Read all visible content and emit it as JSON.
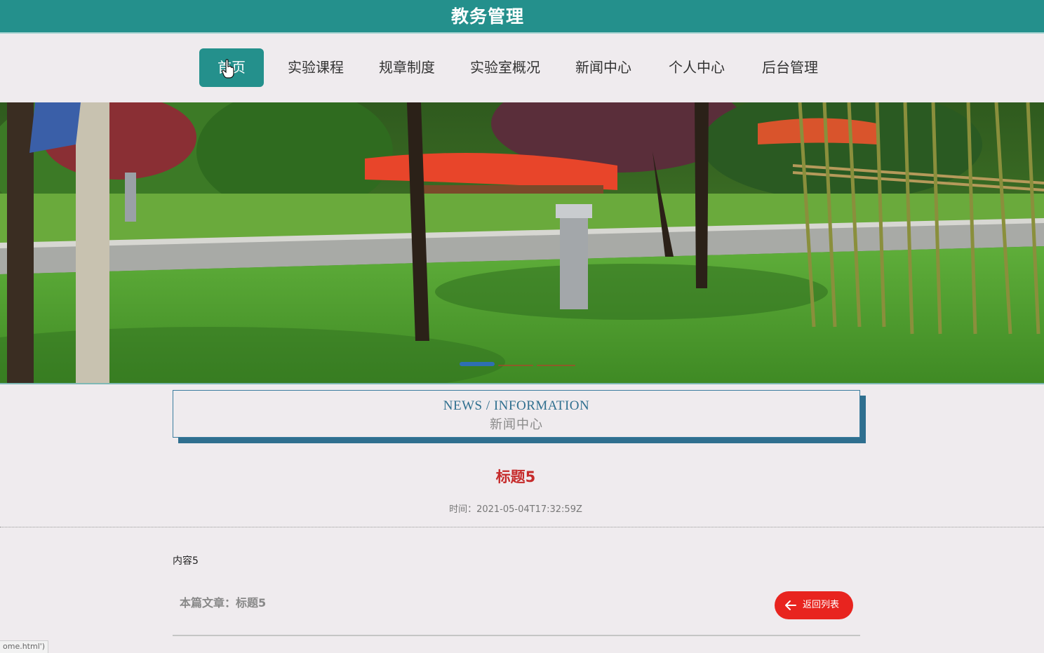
{
  "header": {
    "title": "教务管理"
  },
  "nav": {
    "items": [
      {
        "label": "首页",
        "active": true
      },
      {
        "label": "实验课程",
        "active": false
      },
      {
        "label": "规章制度",
        "active": false
      },
      {
        "label": "实验室概况",
        "active": false
      },
      {
        "label": "新闻中心",
        "active": false
      },
      {
        "label": "个人中心",
        "active": false
      },
      {
        "label": "后台管理",
        "active": false
      }
    ]
  },
  "banner": {
    "slides": 3,
    "active_slide": 1,
    "colors": {
      "active_dot": "#2e6fb3",
      "inactive_dot": "#c0392b"
    }
  },
  "section": {
    "title_en": "NEWS / INFORMATION",
    "title_cn": "新闻中心"
  },
  "article": {
    "title": "标题5",
    "time": "时间：2021-05-04T17:32:59Z",
    "content": "内容5",
    "current_label": "本篇文章：标题5",
    "back_label": "返回列表"
  },
  "status_bar": {
    "url": "ome.html')"
  },
  "colors": {
    "primary": "#24908c",
    "title_red": "#c62b2b",
    "button_red": "#e8241f",
    "page_bg": "#efebee",
    "section_border": "#2f6f8f"
  },
  "icons": {
    "cursor": "hand-pointer-icon",
    "back": "arrow-left-icon"
  }
}
